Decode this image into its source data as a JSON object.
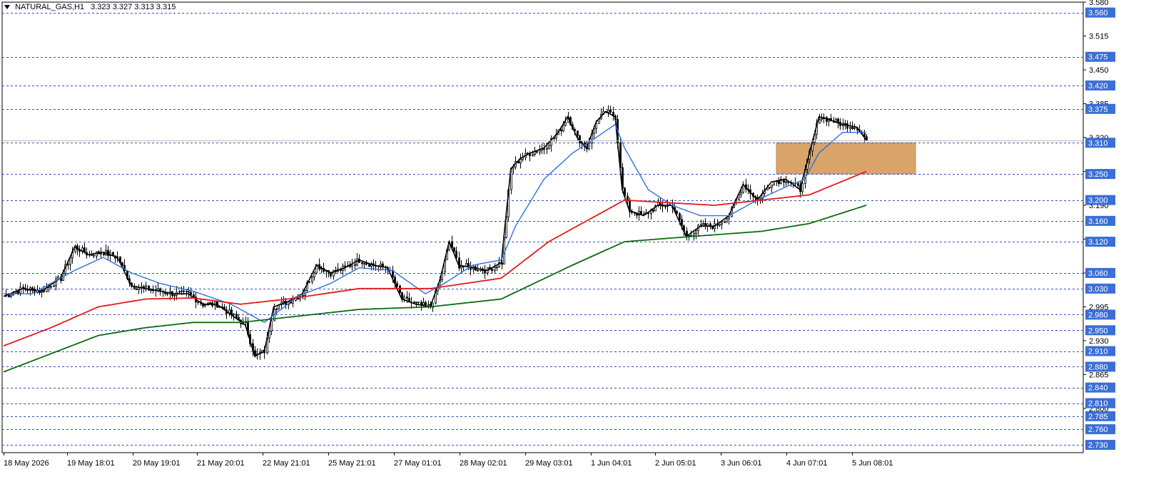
{
  "header": {
    "symbol": "NATURAL_GAS,H1",
    "ohlc": "3.323 3.327 3.313 3.315"
  },
  "colors": {
    "background": "#ffffff",
    "frame": "#000000",
    "grid_level_line": "#2f55b3",
    "level_label_bg": "#3b6fd6",
    "level_label_text": "#ffffff",
    "candle": "#000000",
    "ma_fast": "#000000",
    "ma_mid": "#2f6fe0",
    "ma_slow": "#e8181a",
    "ma_long": "#0b6b10",
    "zone": "#d9a46a",
    "zone_border": "#c08a50"
  },
  "chart_data": {
    "type": "candlestick",
    "title": "NATURAL_GAS,H1",
    "ylim": [
      2.715,
      3.58
    ],
    "price_axis_ticks": [
      "3.580",
      "3.515",
      "3.450",
      "3.385",
      "3.320",
      "3.255",
      "3.190",
      "3.125",
      "3.060",
      "2.995",
      "2.930",
      "2.865",
      "2.800"
    ],
    "x_tick_labels": [
      "18 May 2026",
      "19 May 18:01",
      "20 May 19:01",
      "21 May 20:01",
      "22 May 21:01",
      "25 May 21:01",
      "27 May 01:01",
      "28 May 02:01",
      "29 May 03:01",
      "1 Jun 04:01",
      "2 Jun 05:01",
      "3 Jun 06:01",
      "4 Jun 07:01",
      "5 Jun 08:01"
    ],
    "horizontal_levels": [
      3.56,
      3.475,
      3.42,
      3.375,
      3.31,
      3.25,
      3.2,
      3.16,
      3.12,
      3.06,
      3.03,
      2.98,
      2.95,
      2.91,
      2.88,
      2.84,
      2.81,
      2.785,
      2.76,
      2.73
    ],
    "level_labels": [
      "3.560",
      "3.475",
      "3.420",
      "3.375",
      "3.310",
      "3.250",
      "3.200",
      "3.160",
      "3.120",
      "3.060",
      "3.030",
      "2.980",
      "2.950",
      "2.910",
      "2.880",
      "2.840",
      "2.810",
      "2.785",
      "2.760",
      "2.730"
    ],
    "current_price": 3.315,
    "zone": {
      "from_date": "4 Jun 2026",
      "to_date": "6 Jun 2026",
      "price_low": 3.25,
      "price_high": 3.31
    },
    "close_path": [
      [
        0,
        3.015
      ],
      [
        8,
        3.03
      ],
      [
        16,
        3.025
      ],
      [
        24,
        3.05
      ],
      [
        30,
        3.11
      ],
      [
        36,
        3.095
      ],
      [
        42,
        3.1
      ],
      [
        48,
        3.09
      ],
      [
        54,
        3.035
      ],
      [
        60,
        3.03
      ],
      [
        66,
        3.025
      ],
      [
        72,
        3.02
      ],
      [
        78,
        3.02
      ],
      [
        84,
        3.0
      ],
      [
        90,
        3.0
      ],
      [
        96,
        2.98
      ],
      [
        102,
        2.96
      ],
      [
        106,
        2.9
      ],
      [
        110,
        2.91
      ],
      [
        114,
        2.995
      ],
      [
        120,
        3.005
      ],
      [
        126,
        3.02
      ],
      [
        132,
        3.075
      ],
      [
        138,
        3.06
      ],
      [
        144,
        3.07
      ],
      [
        150,
        3.085
      ],
      [
        156,
        3.075
      ],
      [
        162,
        3.07
      ],
      [
        168,
        3.01
      ],
      [
        174,
        3.0
      ],
      [
        180,
        2.995
      ],
      [
        184,
        3.045
      ],
      [
        188,
        3.12
      ],
      [
        192,
        3.075
      ],
      [
        198,
        3.07
      ],
      [
        204,
        3.065
      ],
      [
        210,
        3.08
      ],
      [
        214,
        3.26
      ],
      [
        218,
        3.28
      ],
      [
        222,
        3.29
      ],
      [
        228,
        3.3
      ],
      [
        234,
        3.33
      ],
      [
        238,
        3.36
      ],
      [
        242,
        3.32
      ],
      [
        246,
        3.3
      ],
      [
        250,
        3.35
      ],
      [
        254,
        3.37
      ],
      [
        258,
        3.36
      ],
      [
        261,
        3.22
      ],
      [
        264,
        3.18
      ],
      [
        270,
        3.17
      ],
      [
        276,
        3.19
      ],
      [
        282,
        3.19
      ],
      [
        288,
        3.13
      ],
      [
        294,
        3.15
      ],
      [
        300,
        3.15
      ],
      [
        306,
        3.17
      ],
      [
        312,
        3.23
      ],
      [
        318,
        3.2
      ],
      [
        324,
        3.235
      ],
      [
        330,
        3.24
      ],
      [
        336,
        3.22
      ],
      [
        340,
        3.29
      ],
      [
        344,
        3.36
      ],
      [
        348,
        3.355
      ],
      [
        354,
        3.345
      ],
      [
        360,
        3.34
      ],
      [
        364,
        3.315
      ]
    ],
    "series": [
      {
        "values": [
          [
            0,
            3.02
          ],
          [
            12,
            3.02
          ],
          [
            30,
            3.065
          ],
          [
            42,
            3.09
          ],
          [
            54,
            3.06
          ],
          [
            66,
            3.04
          ],
          [
            80,
            3.025
          ],
          [
            96,
            3.0
          ],
          [
            110,
            2.965
          ],
          [
            124,
            3.015
          ],
          [
            138,
            3.04
          ],
          [
            150,
            3.07
          ],
          [
            164,
            3.065
          ],
          [
            178,
            3.02
          ],
          [
            186,
            3.04
          ],
          [
            198,
            3.075
          ],
          [
            210,
            3.085
          ],
          [
            216,
            3.15
          ],
          [
            228,
            3.24
          ],
          [
            240,
            3.29
          ],
          [
            250,
            3.32
          ],
          [
            258,
            3.345
          ],
          [
            262,
            3.3
          ],
          [
            272,
            3.22
          ],
          [
            282,
            3.19
          ],
          [
            294,
            3.17
          ],
          [
            306,
            3.17
          ],
          [
            318,
            3.2
          ],
          [
            330,
            3.225
          ],
          [
            338,
            3.24
          ],
          [
            344,
            3.29
          ],
          [
            354,
            3.33
          ],
          [
            364,
            3.33
          ]
        ]
      },
      {
        "values": [
          [
            0,
            2.92
          ],
          [
            20,
            2.955
          ],
          [
            40,
            2.995
          ],
          [
            60,
            3.01
          ],
          [
            80,
            3.012
          ],
          [
            100,
            3.0
          ],
          [
            120,
            3.01
          ],
          [
            150,
            3.03
          ],
          [
            180,
            3.03
          ],
          [
            210,
            3.05
          ],
          [
            230,
            3.12
          ],
          [
            250,
            3.17
          ],
          [
            262,
            3.2
          ],
          [
            280,
            3.195
          ],
          [
            300,
            3.19
          ],
          [
            320,
            3.2
          ],
          [
            340,
            3.21
          ],
          [
            364,
            3.255
          ]
        ]
      },
      {
        "values": [
          [
            0,
            2.87
          ],
          [
            20,
            2.905
          ],
          [
            40,
            2.94
          ],
          [
            60,
            2.955
          ],
          [
            80,
            2.965
          ],
          [
            100,
            2.965
          ],
          [
            120,
            2.975
          ],
          [
            150,
            2.99
          ],
          [
            180,
            2.995
          ],
          [
            210,
            3.01
          ],
          [
            240,
            3.075
          ],
          [
            262,
            3.12
          ],
          [
            290,
            3.13
          ],
          [
            320,
            3.14
          ],
          [
            340,
            3.155
          ],
          [
            364,
            3.19
          ]
        ]
      }
    ]
  }
}
